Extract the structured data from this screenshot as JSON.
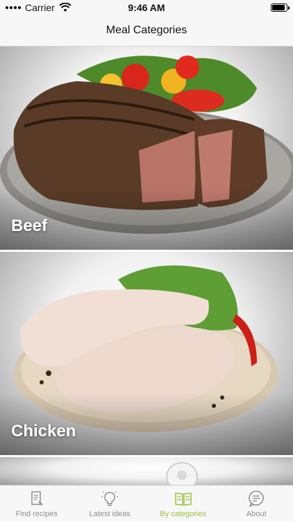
{
  "status": {
    "carrier": "Carrier",
    "time": "9:46 AM"
  },
  "nav": {
    "title": "Meal Categories"
  },
  "categories": [
    {
      "name": "Beef"
    },
    {
      "name": "Chicken"
    }
  ],
  "tabs": [
    {
      "label": "Find recipes",
      "icon": "recipe-book-icon"
    },
    {
      "label": "Latest ideas",
      "icon": "lightbulb-icon"
    },
    {
      "label": "By categories",
      "icon": "open-book-icon"
    },
    {
      "label": "About",
      "icon": "chat-bubble-icon"
    }
  ],
  "colors": {
    "active_tab": "#9bbf3a",
    "inactive_tab": "#8e8e8e"
  }
}
